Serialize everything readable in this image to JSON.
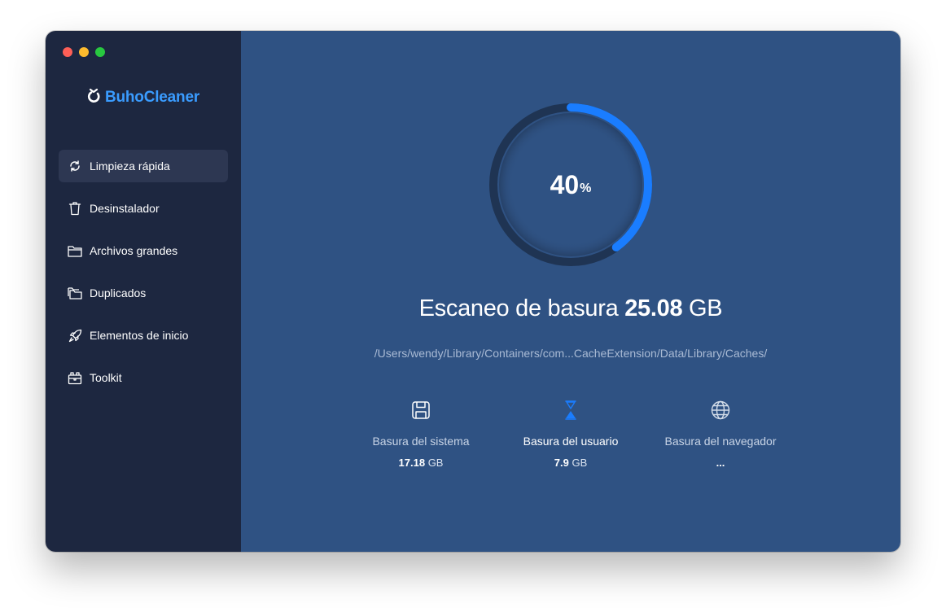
{
  "app": {
    "brand": "BuhoCleaner",
    "brand_color": "#3a9cff"
  },
  "sidebar": {
    "items": [
      {
        "label": "Limpieza rápida",
        "icon": "refresh-icon",
        "active": true
      },
      {
        "label": "Desinstalador",
        "icon": "trash-icon",
        "active": false
      },
      {
        "label": "Archivos grandes",
        "icon": "folder-icon",
        "active": false
      },
      {
        "label": "Duplicados",
        "icon": "duplicate-folder-icon",
        "active": false
      },
      {
        "label": "Elementos de inicio",
        "icon": "rocket-icon",
        "active": false
      },
      {
        "label": "Toolkit",
        "icon": "toolkit-icon",
        "active": false
      }
    ]
  },
  "progress": {
    "value": 40,
    "symbol": "%",
    "track_color": "#1f3453",
    "fill_color": "#1a7dff"
  },
  "scan": {
    "title": "Escaneo de basura",
    "size_value": "25.08",
    "size_unit": "GB",
    "path": "/Users/wendy/Library/Containers/com...CacheExtension/Data/Library/Caches/"
  },
  "categories": [
    {
      "label": "Basura del sistema",
      "size_value": "17.18",
      "size_unit": "GB",
      "icon": "floppy-disk-icon"
    },
    {
      "label": "Basura del usuario",
      "size_value": "7.9",
      "size_unit": "GB",
      "icon": "hourglass-icon"
    },
    {
      "label": "Basura del navegador",
      "size_value": "...",
      "size_unit": "",
      "icon": "globe-icon"
    }
  ]
}
